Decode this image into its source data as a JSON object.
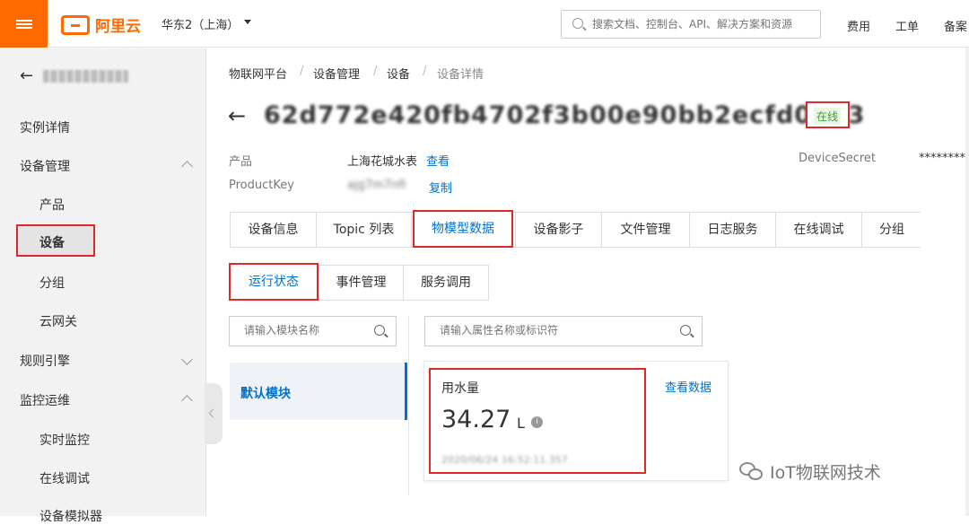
{
  "header": {
    "logo_text": "阿里云",
    "region": "华东2（上海）",
    "search_placeholder": "搜索文档、控制台、API、解决方案和资源",
    "nav": [
      "费用",
      "工单",
      "备案"
    ]
  },
  "sidebar": {
    "back_arrow": "←",
    "items": [
      {
        "label": "实例详情"
      },
      {
        "label": "设备管理"
      },
      {
        "label": "产品"
      },
      {
        "label": "设备"
      },
      {
        "label": "分组"
      },
      {
        "label": "云网关"
      },
      {
        "label": "规则引擎"
      },
      {
        "label": "监控运维"
      },
      {
        "label": "实时监控"
      },
      {
        "label": "在线调试"
      },
      {
        "label": "设备模拟器"
      }
    ]
  },
  "breadcrumb": [
    "物联网平台",
    "设备管理",
    "设备",
    "设备详情"
  ],
  "device": {
    "back_arrow": "←",
    "name": "62d772e420fb4702f3b00e90bb2ecfd0213",
    "status": "在线",
    "product_label": "产品",
    "product_value": "上海花城水表",
    "product_link": "查看",
    "productkey_label": "ProductKey",
    "productkey_value": "ajg7m7nfi",
    "productkey_link": "复制",
    "secret_label": "DeviceSecret",
    "secret_value": "********"
  },
  "tabs": [
    "设备信息",
    "Topic 列表",
    "物模型数据",
    "设备影子",
    "文件管理",
    "日志服务",
    "在线调试",
    "分组"
  ],
  "subtabs": [
    "运行状态",
    "事件管理",
    "服务调用"
  ],
  "module_search_placeholder": "请输入模块名称",
  "property_search_placeholder": "请输入属性名称或标识符",
  "module_default": "默认模块",
  "property": {
    "name": "用水量",
    "value": "34.27",
    "unit": "L",
    "view_data": "查看数据",
    "time": "2020/06/24 16:52:11.357"
  },
  "watermark": "IoT物联网技术",
  "colors": {
    "accent": "#ff6a00",
    "link": "#0070cc",
    "highlight": "#e02828",
    "online": "#3e9b35"
  }
}
